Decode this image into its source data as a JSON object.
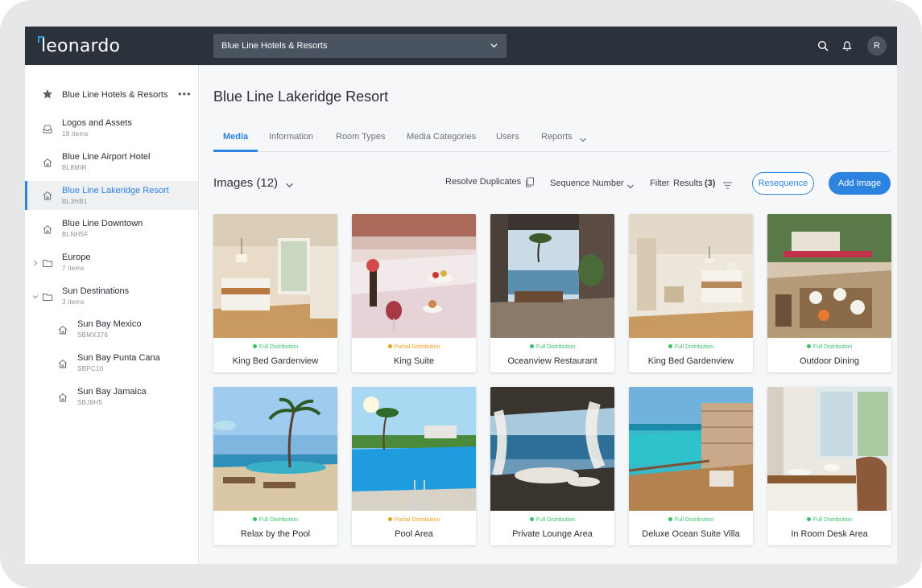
{
  "app": {
    "logo": "leonardo"
  },
  "header": {
    "org_select": "Blue Line Hotels & Resorts",
    "avatar_initial": "R"
  },
  "sidebar": {
    "root": {
      "label": "Blue Line Hotels & Resorts"
    },
    "items": [
      {
        "label": "Logos and Assets",
        "sub": "18 items",
        "icon": "inbox-icon"
      },
      {
        "label": "Blue Line Airport Hotel",
        "sub": "BL8MIR",
        "icon": "home-icon"
      },
      {
        "label": "Blue Line Lakeridge Resort",
        "sub": "BL3HB1",
        "icon": "home-icon",
        "active": true
      },
      {
        "label": "Blue Line Downtown",
        "sub": "BLNH5F",
        "icon": "home-icon"
      },
      {
        "label": "Europe",
        "sub": "7 items",
        "icon": "folder-icon"
      },
      {
        "label": "Sun Destinations",
        "sub": "3 items",
        "icon": "folder-icon"
      },
      {
        "label": "Sun Bay Mexico",
        "sub": "SBMX376",
        "icon": "home-icon"
      },
      {
        "label": "Sun Bay Punta Cana",
        "sub": "SBPC10",
        "icon": "home-icon"
      },
      {
        "label": "Sun Bay Jamaica",
        "sub": "SBJ8H5",
        "icon": "home-icon"
      }
    ]
  },
  "main": {
    "title": "Blue Line Lakeridge Resort",
    "tabs": [
      {
        "label": "Media"
      },
      {
        "label": "Information"
      },
      {
        "label": "Room Types"
      },
      {
        "label": "Media Categories"
      },
      {
        "label": "Users"
      },
      {
        "label": "Reports"
      }
    ],
    "toolbar": {
      "images_label": "Images (12)",
      "resolve_duplicates": "Resolve Duplicates",
      "sort_label": "Sequence Number",
      "filter_label": "Filter",
      "results_label": "Results",
      "results_count": "(3)",
      "resequence_button": "Resequence",
      "add_image_button": "Add Image"
    },
    "status_colors": {
      "full": "#3cbf6a",
      "partial": "#f0a020"
    },
    "cards": [
      {
        "title": "King Bed Gardenview",
        "status": "Full Distribution",
        "status_type": "full"
      },
      {
        "title": "King Suite",
        "status": "Partial Distribution",
        "status_type": "partial"
      },
      {
        "title": "Oceanview Restaurant",
        "status": "Full Distribution",
        "status_type": "full"
      },
      {
        "title": "King Bed Gardenview",
        "status": "Full Distribution",
        "status_type": "full"
      },
      {
        "title": "Outdoor Dining",
        "status": "Full Distribution",
        "status_type": "full"
      },
      {
        "title": "Relax by the Pool",
        "status": "Full Distribution",
        "status_type": "full"
      },
      {
        "title": "Pool Area",
        "status": "Partial Distribution",
        "status_type": "partial"
      },
      {
        "title": "Private Lounge Area",
        "status": "Full Distribution",
        "status_type": "full"
      },
      {
        "title": "Deluxe Ocean Suite Villa",
        "status": "Full Distribution",
        "status_type": "full"
      },
      {
        "title": "In Room Desk Area",
        "status": "Full Distribution",
        "status_type": "full"
      }
    ]
  }
}
